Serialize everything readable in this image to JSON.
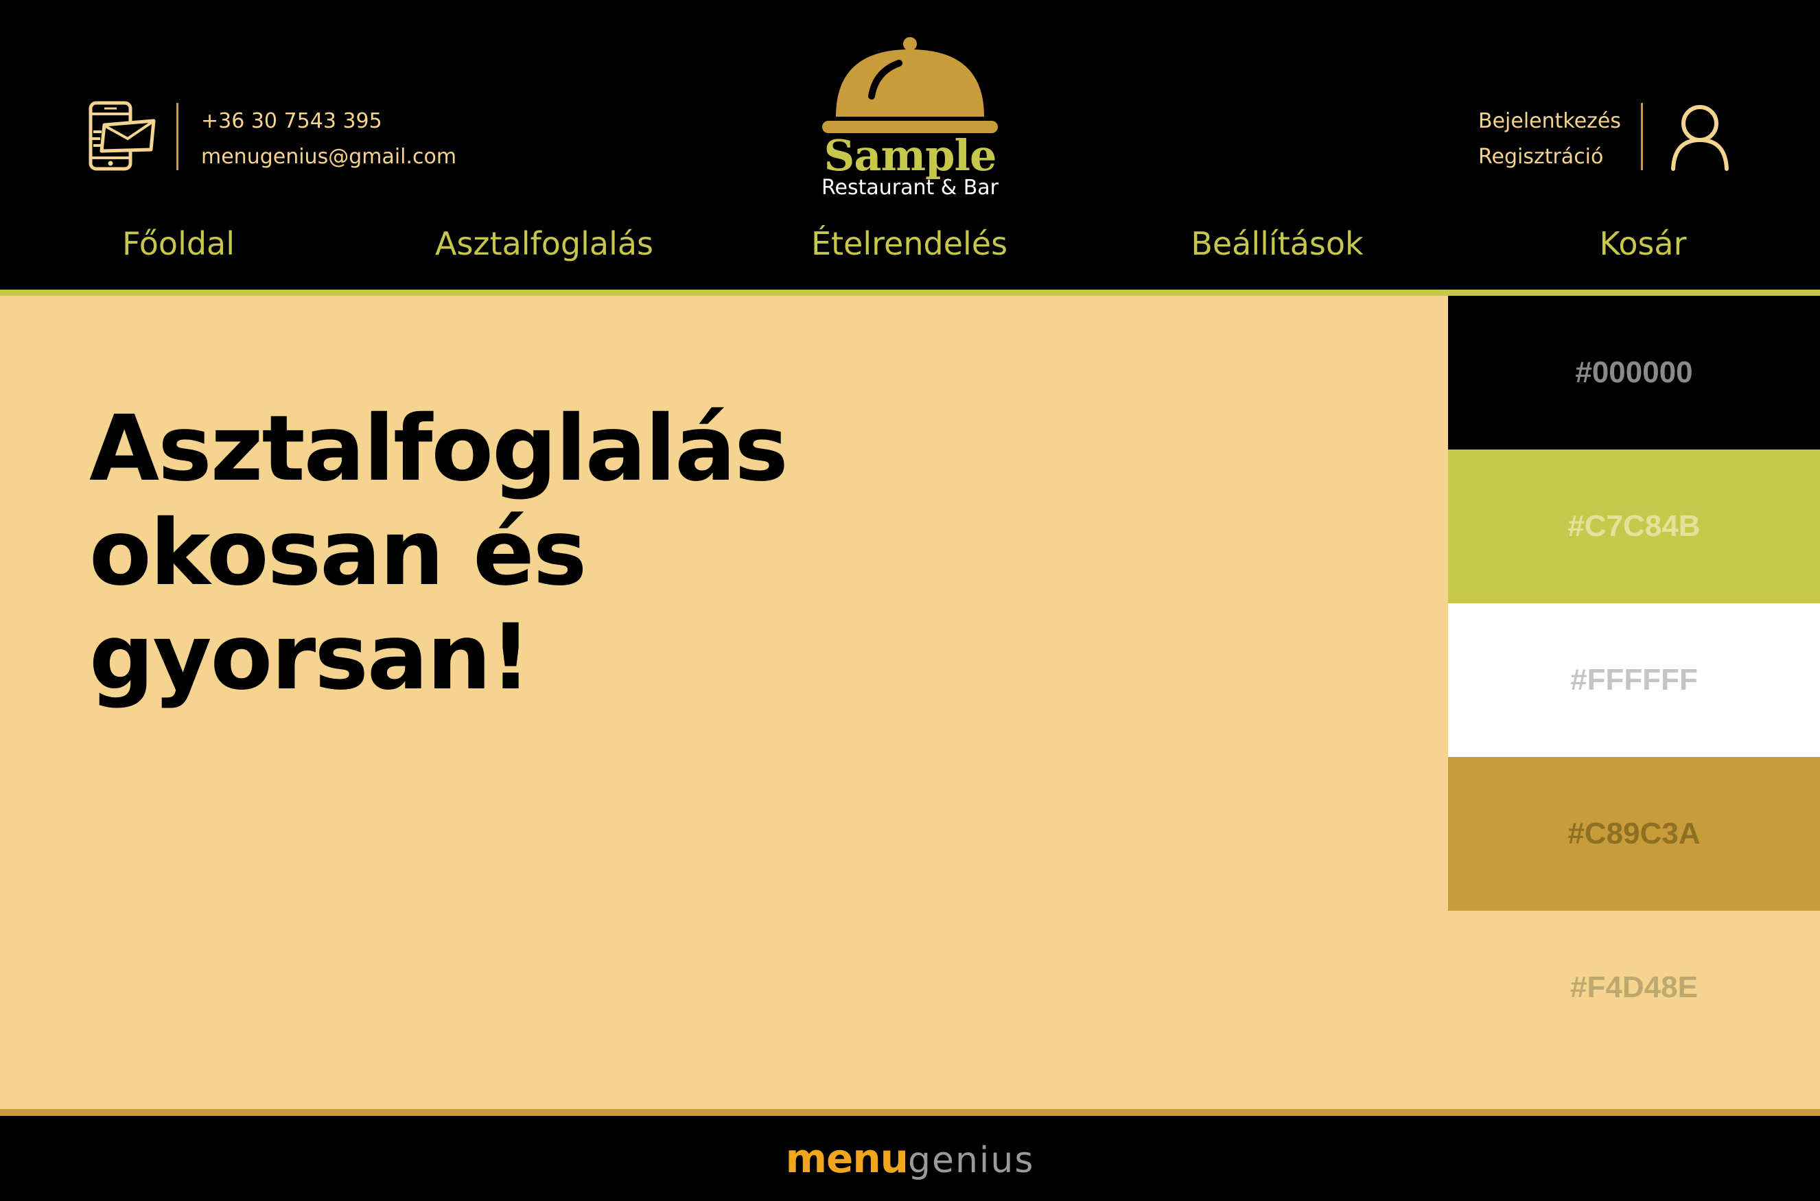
{
  "header": {
    "contact": {
      "icon": "phone-mail-icon",
      "phone": "+36 30 7543 395",
      "email": "menugenius@gmail.com"
    },
    "logo": {
      "icon": "serving-cloche-icon",
      "name": "Sample",
      "subtitle": "Restaurant & Bar"
    },
    "auth": {
      "login": "Bejelentkezés",
      "register": "Regisztráció",
      "icon": "user-icon"
    },
    "nav": [
      {
        "label": "Főoldal"
      },
      {
        "label": "Asztalfoglalás"
      },
      {
        "label": "Ételrendelés"
      },
      {
        "label": "Beállítások"
      },
      {
        "label": "Kosár"
      }
    ]
  },
  "hero": {
    "line1": "Asztalfoglalás",
    "line2": "okosan és",
    "line3": "gyorsan!"
  },
  "palette": [
    {
      "hex": "#000000",
      "label": "#000000",
      "label_color": "#8A8A8A"
    },
    {
      "hex": "#C7C84B",
      "label": "#C7C84B",
      "label_color": "#E2E29A"
    },
    {
      "hex": "#FFFFFF",
      "label": "#FFFFFF",
      "label_color": "#C4C4C4"
    },
    {
      "hex": "#C89C3A",
      "label": "#C89C3A",
      "label_color": "#8F6F22"
    },
    {
      "hex": "#F4D48E",
      "label": "#F4D48E",
      "label_color": "#BFA870"
    }
  ],
  "footer": {
    "brand_bold": "menu",
    "brand_light": "genius"
  },
  "colors": {
    "black": "#000000",
    "olive": "#C7C84B",
    "gold": "#C89C3A",
    "sand": "#F4D48E",
    "white": "#FFFFFF"
  }
}
